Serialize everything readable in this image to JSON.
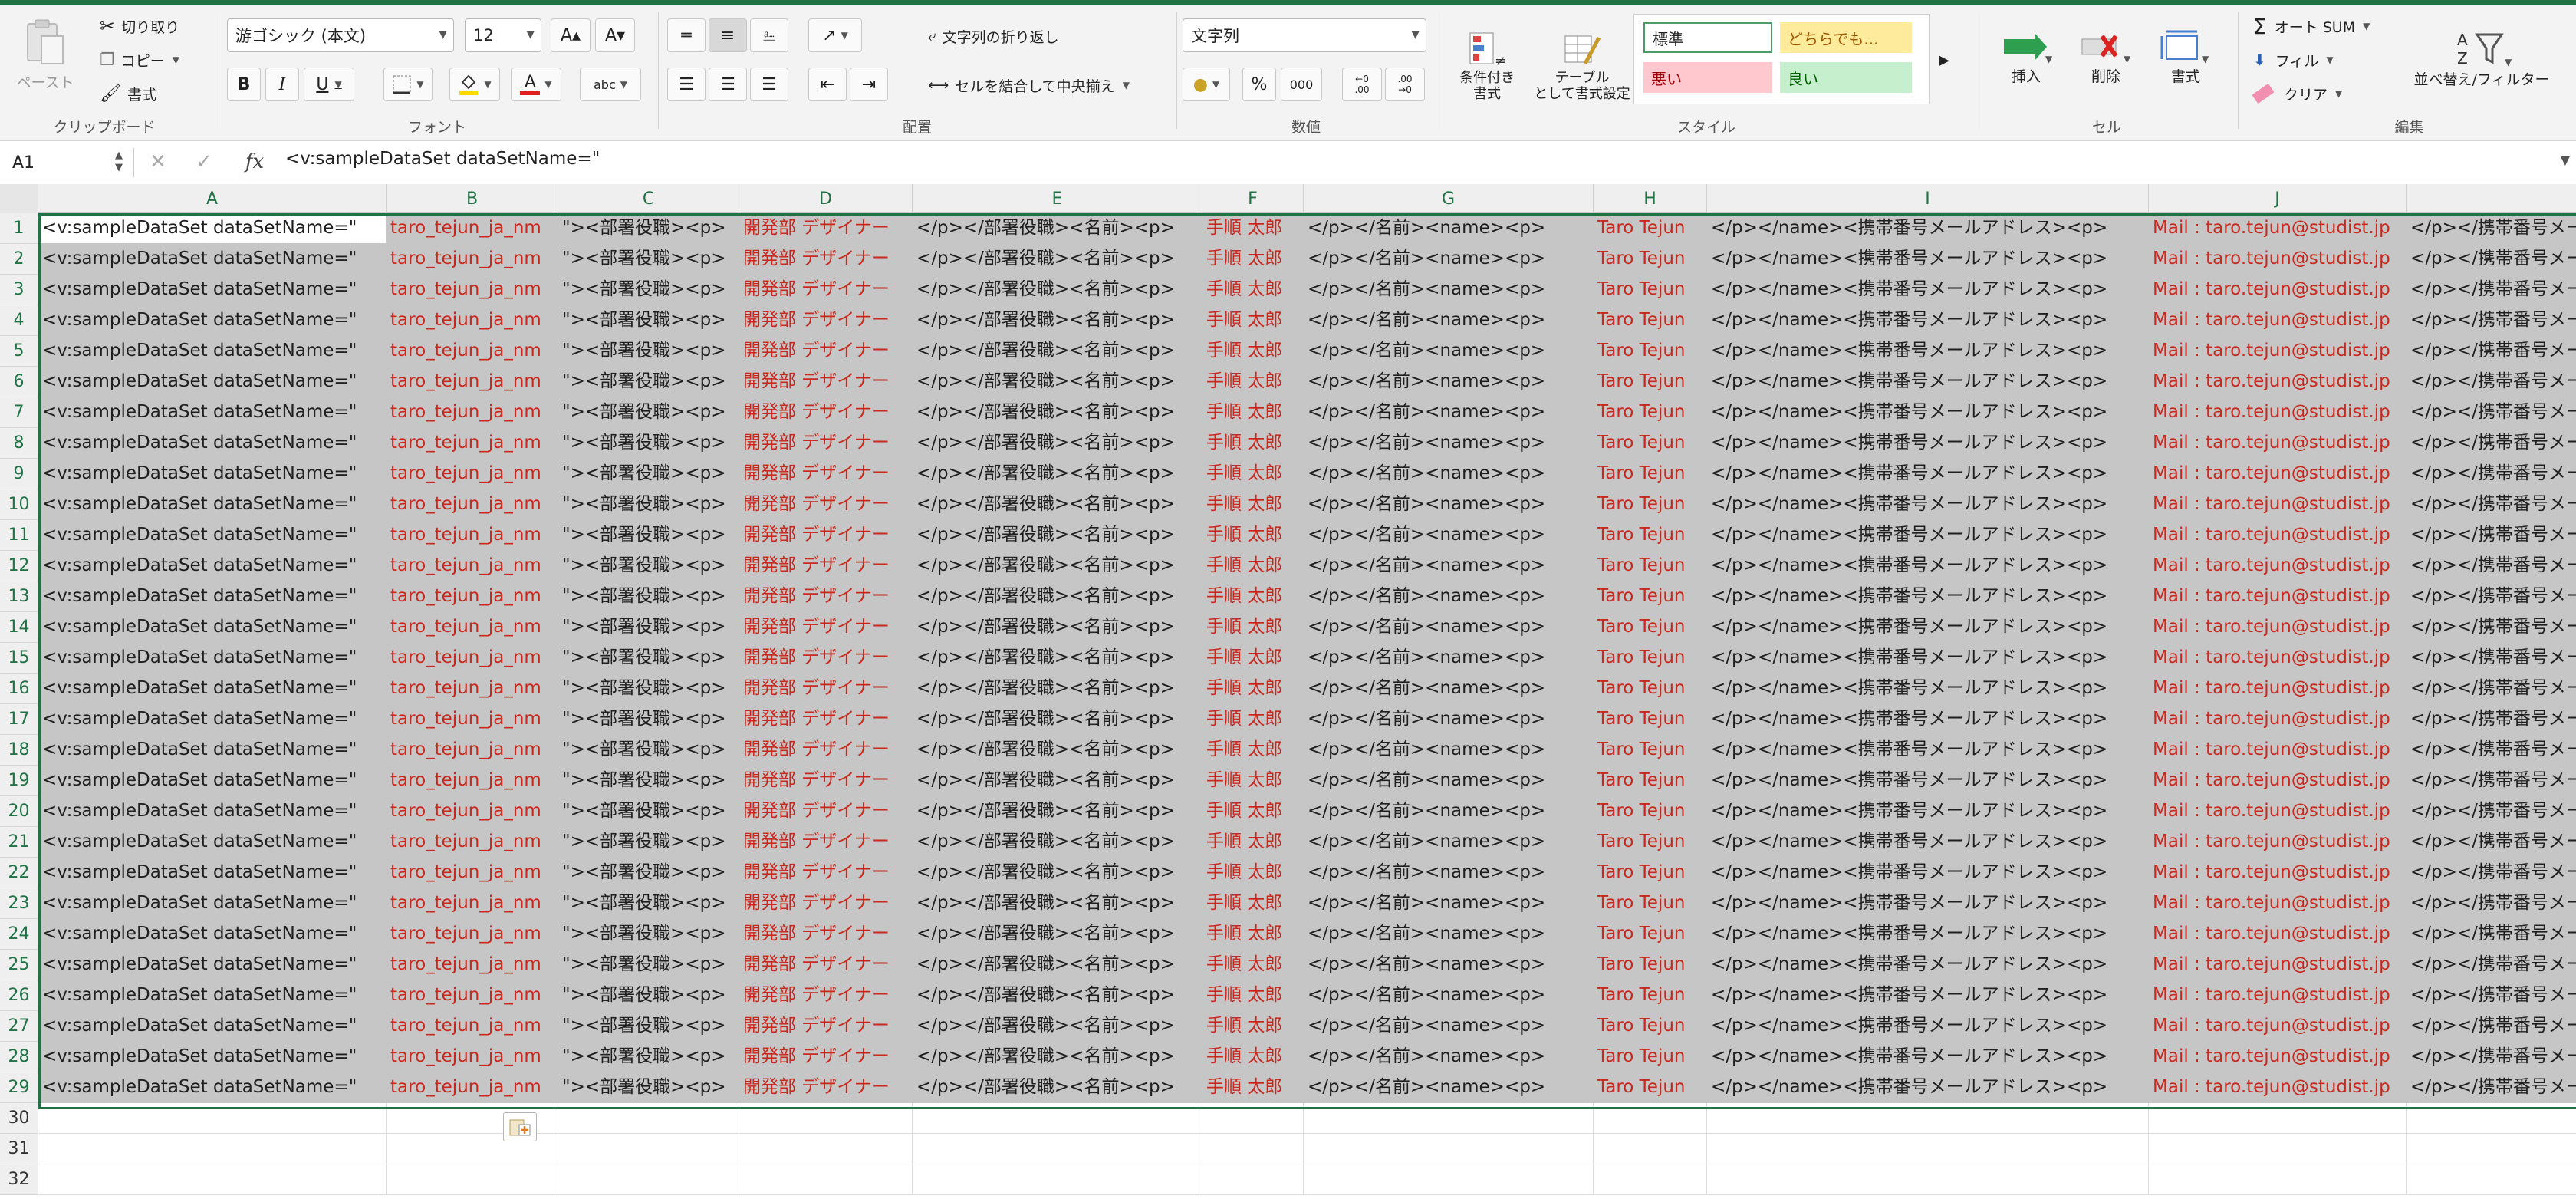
{
  "ribbon": {
    "clipboard": {
      "paste": "ペースト",
      "cut": "切り取り",
      "copy": "コピー",
      "format_painter": "書式",
      "group": "クリップボード"
    },
    "font": {
      "name": "游ゴシック (本文)",
      "size": "12",
      "group": "フォント",
      "bold": "B",
      "italic": "I",
      "underline": "U",
      "grow": "A▴",
      "shrink": "A▾",
      "font_color_glyph": "A",
      "phonetic": "abc"
    },
    "alignment": {
      "wrap": "文字列の折り返し",
      "merge": "セルを結合して中央揃え",
      "group": "配置"
    },
    "number": {
      "format": "文字列",
      "percent": "%",
      "comma": "000",
      "inc_decimal": "←0\n.00",
      "dec_decimal": ".00\n→0",
      "group": "数値"
    },
    "styles": {
      "conditional": "条件付き\n書式",
      "table": "テーブル\nとして書式設定",
      "normal": "標準",
      "neutral": "どちらでも...",
      "bad": "悪い",
      "good": "良い",
      "group": "スタイル"
    },
    "cells": {
      "insert": "挿入",
      "delete": "削除",
      "format": "書式",
      "group": "セル"
    },
    "editing": {
      "autosum": "オート SUM",
      "fill": "フィル",
      "clear": "クリア",
      "sort_filter": "並べ替え/フィルター",
      "group": "編集"
    },
    "colors": {
      "accent": "#217346",
      "fill_yellow": "#ffd800",
      "font_red": "#e02020"
    }
  },
  "formula_bar": {
    "name_box": "A1",
    "content": "<v:sampleDataSet  dataSetName=\""
  },
  "columns": [
    {
      "label": "A"
    },
    {
      "label": "B"
    },
    {
      "label": "C"
    },
    {
      "label": "D"
    },
    {
      "label": "E"
    },
    {
      "label": "F"
    },
    {
      "label": "G"
    },
    {
      "label": "H"
    },
    {
      "label": "I"
    },
    {
      "label": "J"
    },
    {
      "label": ""
    }
  ],
  "row_values": [
    "<v:sampleDataSet  dataSetName=\"",
    "taro_tejun_ja_nm",
    "\"><部署役職><p>",
    "開発部 デザイナー",
    "</p></部署役職><名前><p>",
    "手順 太郎",
    "</p></名前><name><p>",
    "Taro Tejun",
    "</p></name><携帯番号メールアドレス><p>",
    "Mail : taro.tejun@studist.jp",
    "</p></携帯番号メー"
  ],
  "data_rows": [
    "1",
    "2",
    "3",
    "4",
    "5",
    "6",
    "7",
    "8",
    "9",
    "10",
    "11",
    "12",
    "13",
    "14",
    "15",
    "16",
    "17",
    "18",
    "19",
    "20",
    "21",
    "22",
    "23",
    "24",
    "25",
    "26",
    "27",
    "28",
    "29"
  ],
  "empty_rows": [
    "30",
    "31",
    "32"
  ]
}
